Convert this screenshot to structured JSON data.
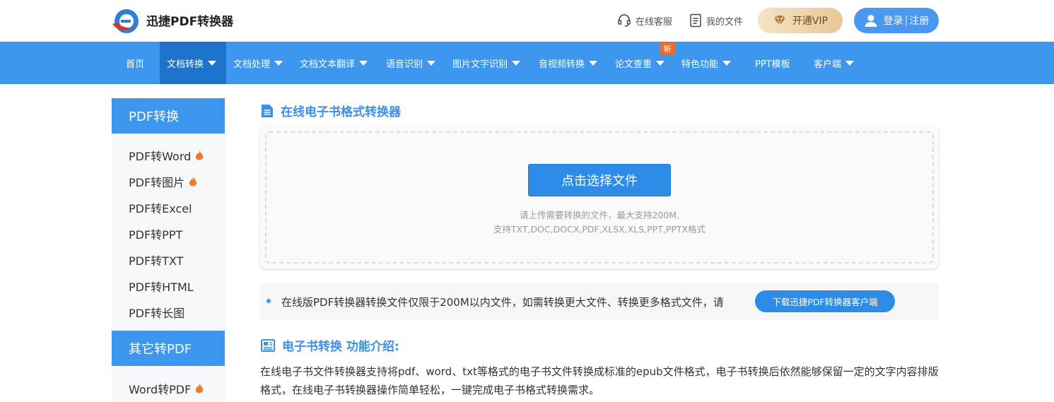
{
  "header": {
    "logo_text": "迅捷PDF转换器",
    "service_label": "在线客服",
    "files_label": "我的文件",
    "vip_label": "开通VIP",
    "login_label": "登录",
    "register_label": "注册"
  },
  "nav": {
    "items": [
      {
        "label": "首页"
      },
      {
        "label": "文档转换"
      },
      {
        "label": "文档处理"
      },
      {
        "label": "文档文本翻译"
      },
      {
        "label": "语音识别"
      },
      {
        "label": "图片文字识别"
      },
      {
        "label": "音视频转换"
      },
      {
        "label": "论文查重"
      },
      {
        "label": "特色功能"
      },
      {
        "label": "PPT模板"
      },
      {
        "label": "客户端"
      }
    ],
    "new_badge": "新"
  },
  "sidebar": {
    "group1_title": "PDF转换",
    "group1_items": [
      {
        "label": "PDF转Word"
      },
      {
        "label": "PDF转图片"
      },
      {
        "label": "PDF转Excel"
      },
      {
        "label": "PDF转PPT"
      },
      {
        "label": "PDF转TXT"
      },
      {
        "label": "PDF转HTML"
      },
      {
        "label": "PDF转长图"
      }
    ],
    "group2_title": "其它转PDF",
    "group2_items": [
      {
        "label": "Word转PDF"
      }
    ]
  },
  "main": {
    "title": "在线电子书格式转换器",
    "choose_button": "点击选择文件",
    "hint_line1": "请上传需要转换的文件，最大支持200M,",
    "hint_line2": "支持TXT,DOC,DOCX,PDF,XLSX,XLS,PPT,PPTX格式",
    "notice_text": "在线版PDF转换器转换文件仅限于200M以内文件，如需转换更大文件、转换更多格式文件，请",
    "download_button": "下载迅捷PDF转换器客户端",
    "intro_title": "电子书转换 功能介绍:",
    "intro_body": "在线电子书文件转换器支持将pdf、word、txt等格式的电子书文件转换成标准的epub文件格式，电子书转换后依然能够保留一定的文字内容排版格式，在线电子书转换器操作简单轻松，一键完成电子书格式转换需求。"
  },
  "colors": {
    "brand_blue": "#3d97ee",
    "active_nav": "#1e74cc",
    "button_blue": "#2d8ce8",
    "badge_orange": "#ef6b2c"
  }
}
